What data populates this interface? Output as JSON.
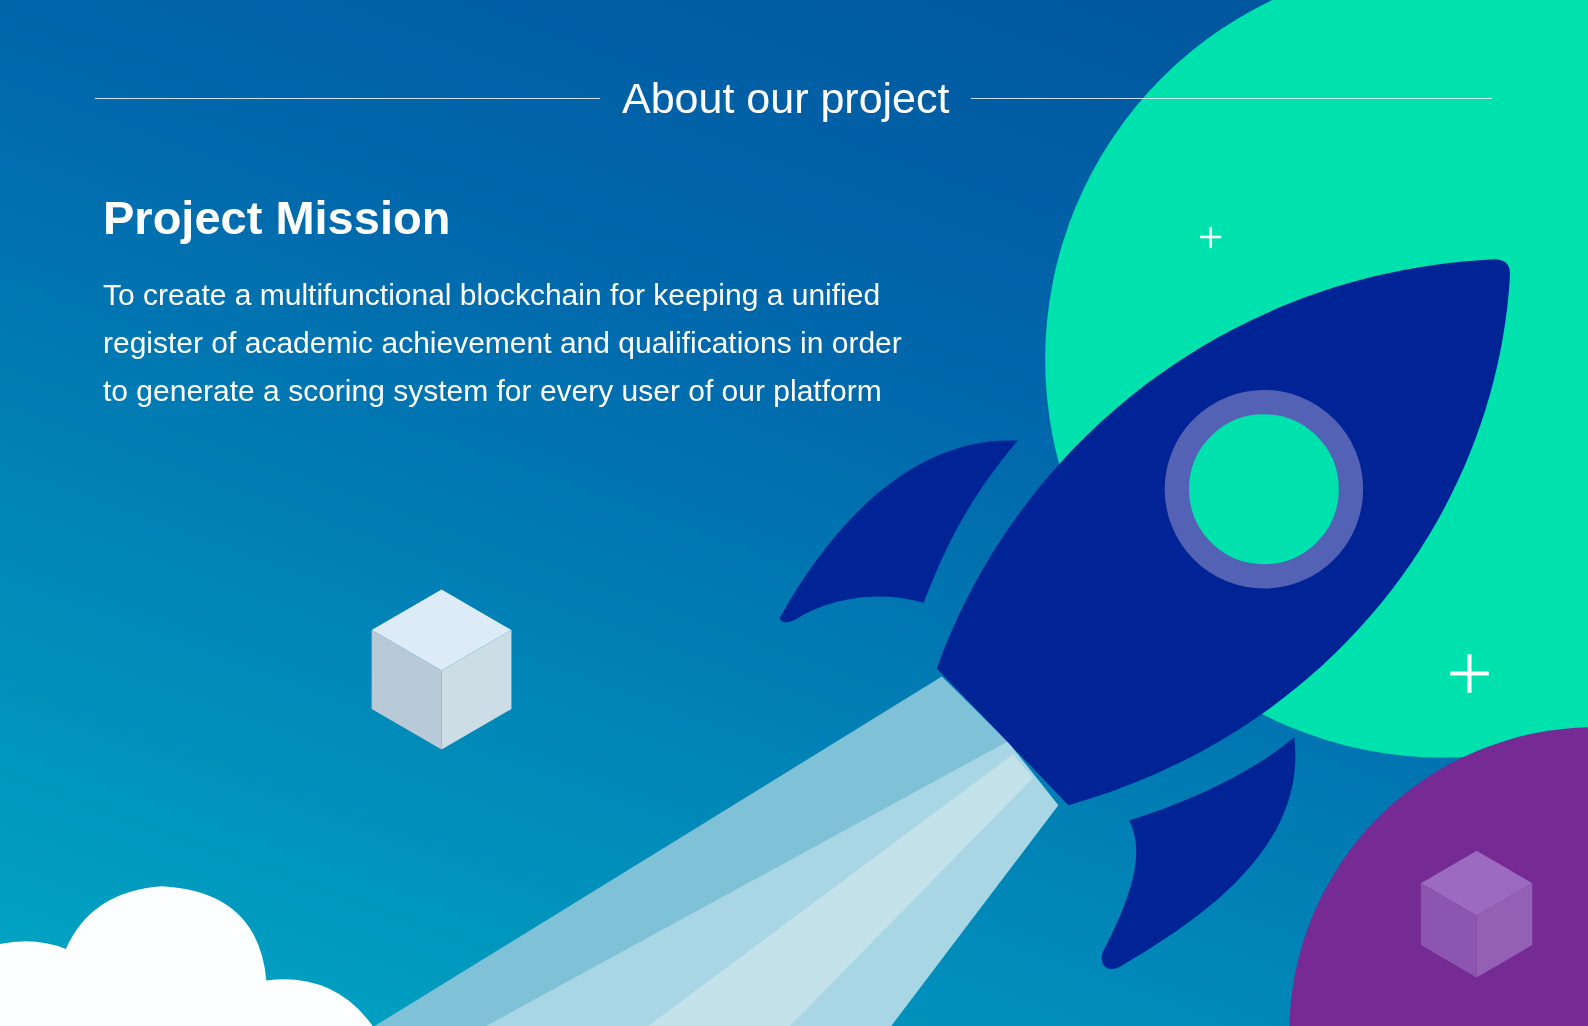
{
  "section_title": "About our project",
  "heading": "Project Mission",
  "paragraph": "To create a multifunctional blockchain for keeping a unified register of academic achievement and qualifications in order to generate a scoring system for every user of our platform"
}
